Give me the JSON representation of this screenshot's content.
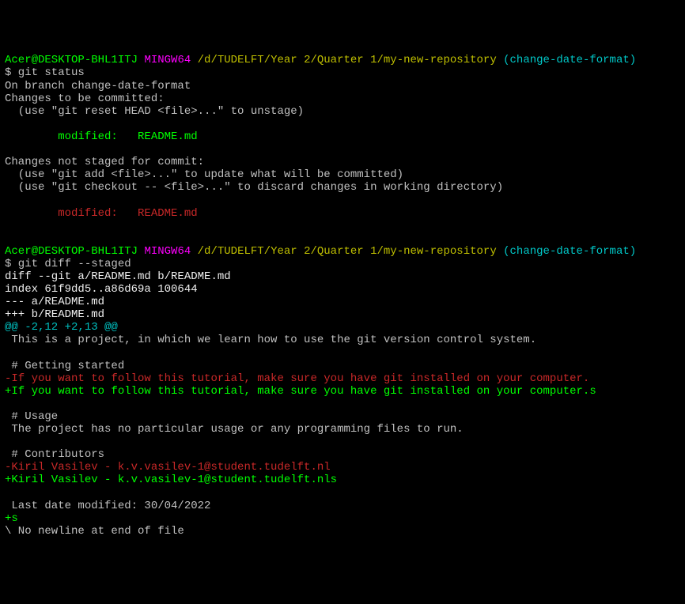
{
  "prompt1": {
    "user_host": "Acer@DESKTOP-BHL1ITJ",
    "env": "MINGW64",
    "path": "/d/TUDELFT/Year 2/Quarter 1/my-new-repository",
    "branch_open": "(",
    "branch": "change-date-format",
    "branch_close": ")"
  },
  "cmd1": "$ git status",
  "status": {
    "on_branch": "On branch change-date-format",
    "to_commit": "Changes to be committed:",
    "unstage_hint": "  (use \"git reset HEAD <file>...\" to unstage)",
    "staged_modified": "        modified:   README.md",
    "not_staged": "Changes not staged for commit:",
    "add_hint": "  (use \"git add <file>...\" to update what will be committed)",
    "checkout_hint": "  (use \"git checkout -- <file>...\" to discard changes in working directory)",
    "unstaged_modified": "        modified:   README.md"
  },
  "prompt2": {
    "user_host": "Acer@DESKTOP-BHL1ITJ",
    "env": "MINGW64",
    "path": "/d/TUDELFT/Year 2/Quarter 1/my-new-repository",
    "branch_open": "(",
    "branch": "change-date-format",
    "branch_close": ")"
  },
  "cmd2": "$ git diff --staged",
  "diff": {
    "header1": "diff --git a/README.md b/README.md",
    "header2": "index 61f9dd5..a86d69a 100644",
    "header3": "--- a/README.md",
    "header4": "+++ b/README.md",
    "hunk": "@@ -2,12 +2,13 @@",
    "ctx1": " This is a project, in which we learn how to use the git version control system.",
    "blank1": " ",
    "ctx2": " # Getting started",
    "del1": "-If you want to follow this tutorial, make sure you have git installed on your computer.",
    "add1": "+If you want to follow this tutorial, make sure you have git installed on your computer.s",
    "blank2": " ",
    "ctx3": " # Usage",
    "ctx4": " The project has no particular usage or any programming files to run.",
    "blank3": " ",
    "ctx5": " # Contributors",
    "del2": "-Kiril Vasilev - k.v.vasilev-1@student.tudelft.nl",
    "add2": "+Kiril Vasilev - k.v.vasilev-1@student.tudelft.nls",
    "blank4": " ",
    "ctx6": " Last date modified: 30/04/2022",
    "add3": "+s",
    "nonewline": "\\ No newline at end of file"
  }
}
